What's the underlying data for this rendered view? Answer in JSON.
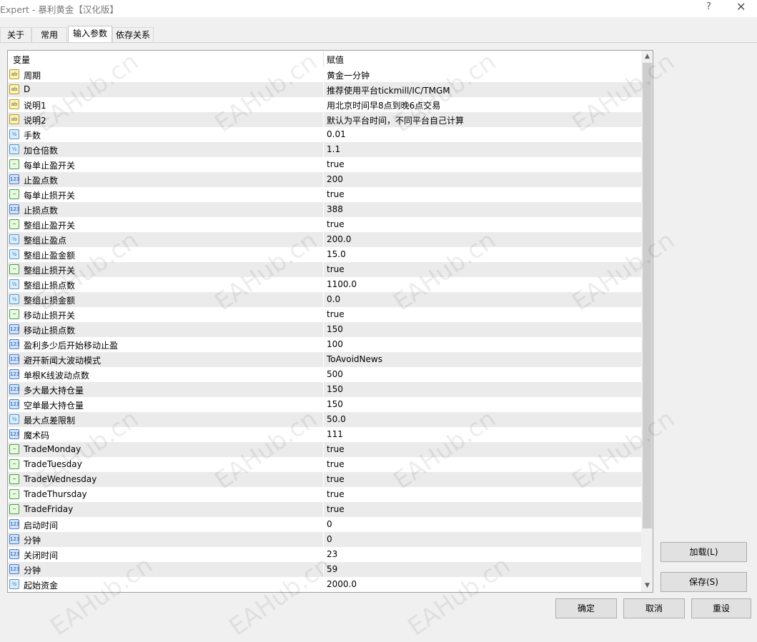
{
  "window": {
    "title": "Expert - 暴利黄金【汉化版】",
    "help": "?",
    "close": "✕"
  },
  "tabs": [
    {
      "label": "关于"
    },
    {
      "label": "常用"
    },
    {
      "label": "输入参数"
    },
    {
      "label": "依存关系"
    }
  ],
  "table": {
    "col_variable": "变量",
    "col_value": "赋值",
    "rows": [
      {
        "type": "string",
        "icon": "ab",
        "name": "周期",
        "value": "黄金一分钟"
      },
      {
        "type": "string",
        "icon": "ab",
        "name": "D",
        "value": "推荐使用平台tickmill/IC/TMGM"
      },
      {
        "type": "string",
        "icon": "ab",
        "name": "说明1",
        "value": "用北京时间早8点到晚6点交易"
      },
      {
        "type": "string",
        "icon": "ab",
        "name": "说明2",
        "value": "默认为平台时间，不同平台自己计算"
      },
      {
        "type": "double",
        "icon": "½",
        "name": "手数",
        "value": "0.01"
      },
      {
        "type": "double",
        "icon": "½",
        "name": "加仓倍数",
        "value": "1.1"
      },
      {
        "type": "bool",
        "icon": "~",
        "name": "每单止盈开关",
        "value": "true"
      },
      {
        "type": "int",
        "icon": "123",
        "name": "止盈点数",
        "value": "200"
      },
      {
        "type": "bool",
        "icon": "~",
        "name": "每单止损开关",
        "value": "true"
      },
      {
        "type": "int",
        "icon": "123",
        "name": "止损点数",
        "value": "388"
      },
      {
        "type": "bool",
        "icon": "~",
        "name": "整组止盈开关",
        "value": "true"
      },
      {
        "type": "double",
        "icon": "½",
        "name": "整组止盈点",
        "value": "200.0"
      },
      {
        "type": "double",
        "icon": "½",
        "name": "整组止盈金额",
        "value": "15.0"
      },
      {
        "type": "bool",
        "icon": "~",
        "name": "整组止损开关",
        "value": "true"
      },
      {
        "type": "double",
        "icon": "½",
        "name": "整组止损点数",
        "value": "1100.0"
      },
      {
        "type": "double",
        "icon": "½",
        "name": "整组止损金额",
        "value": "0.0"
      },
      {
        "type": "bool",
        "icon": "~",
        "name": "移动止损开关",
        "value": "true"
      },
      {
        "type": "int",
        "icon": "123",
        "name": "移动止损点数",
        "value": "150"
      },
      {
        "type": "int",
        "icon": "123",
        "name": "盈利多少后开始移动止盈",
        "value": "100"
      },
      {
        "type": "int",
        "icon": "123",
        "name": "避开新闻大波动模式",
        "value": "ToAvoidNews"
      },
      {
        "type": "int",
        "icon": "123",
        "name": "单根K线波动点数",
        "value": "500"
      },
      {
        "type": "int",
        "icon": "123",
        "name": "多大最大持仓量",
        "value": "150"
      },
      {
        "type": "int",
        "icon": "123",
        "name": "空单最大持仓量",
        "value": "150"
      },
      {
        "type": "double",
        "icon": "½",
        "name": "最大点差限制",
        "value": "50.0"
      },
      {
        "type": "int",
        "icon": "123",
        "name": "魔术码",
        "value": "111"
      },
      {
        "type": "bool",
        "icon": "~",
        "name": "TradeMonday",
        "value": "true"
      },
      {
        "type": "bool",
        "icon": "~",
        "name": "TradeTuesday",
        "value": "true"
      },
      {
        "type": "bool",
        "icon": "~",
        "name": "TradeWednesday",
        "value": "true"
      },
      {
        "type": "bool",
        "icon": "~",
        "name": "TradeThursday",
        "value": "true"
      },
      {
        "type": "bool",
        "icon": "~",
        "name": "TradeFriday",
        "value": "true"
      },
      {
        "type": "int",
        "icon": "123",
        "name": "启动时间",
        "value": "0"
      },
      {
        "type": "int",
        "icon": "123",
        "name": "分钟",
        "value": "0"
      },
      {
        "type": "int",
        "icon": "123",
        "name": "关闭时间",
        "value": "23"
      },
      {
        "type": "int",
        "icon": "123",
        "name": "分钟",
        "value": "59"
      },
      {
        "type": "double",
        "icon": "½",
        "name": "起始资金",
        "value": "2000.0"
      }
    ]
  },
  "buttons": {
    "load": "加载(L)",
    "save": "保存(S)",
    "ok": "确定",
    "cancel": "取消",
    "reset": "重设"
  },
  "watermark": "EAHub.cn"
}
